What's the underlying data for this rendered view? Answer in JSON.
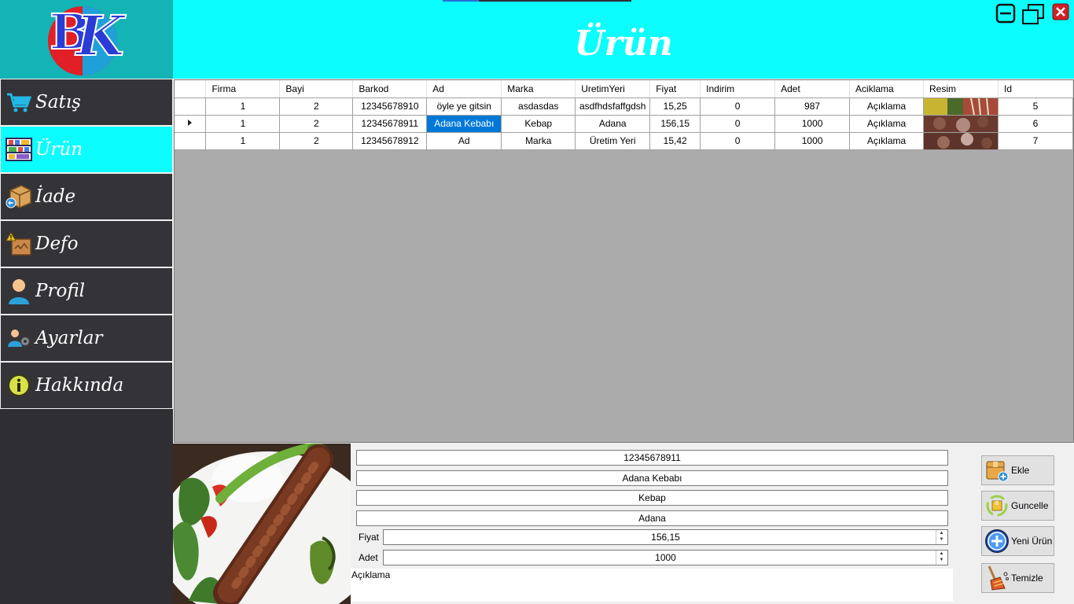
{
  "app": {
    "title": "Ürün"
  },
  "colors": {
    "accent": "#0cfdfd",
    "sidebar": "#2e2e33",
    "selection": "#0078d7",
    "grid_bg": "#ababab"
  },
  "sidebar": {
    "items": [
      {
        "label": "Satış",
        "icon": "cart-icon"
      },
      {
        "label": "Ürün",
        "icon": "shelves-icon",
        "active": true
      },
      {
        "label": "İade",
        "icon": "box-return-icon"
      },
      {
        "label": "Defo",
        "icon": "damaged-box-icon"
      },
      {
        "label": "Profil",
        "icon": "user-icon"
      },
      {
        "label": "Ayarlar",
        "icon": "user-gear-icon"
      },
      {
        "label": "Hakkında",
        "icon": "info-icon"
      }
    ]
  },
  "grid": {
    "columns": [
      "Firma",
      "Bayi",
      "Barkod",
      "Ad",
      "Marka",
      "UretimYeri",
      "Fiyat",
      "Indirim",
      "Adet",
      "Aciklama",
      "Resim",
      "Id"
    ],
    "rows": [
      [
        "1",
        "2",
        "12345678910",
        "öyle ye gitsin",
        "asdasdas",
        "asdfhdsfaffgdsh",
        "15,25",
        "0",
        "987",
        "Açıklama",
        "",
        "5"
      ],
      [
        "1",
        "2",
        "12345678911",
        "Adana Kebabı",
        "Kebap",
        "Adana",
        "156,15",
        "0",
        "1000",
        "Açıklama",
        "",
        "6"
      ],
      [
        "1",
        "2",
        "12345678912",
        "Ad",
        "Marka",
        "Üretim Yeri",
        "15,42",
        "0",
        "1000",
        "Açıklama",
        "",
        "7"
      ]
    ],
    "current_row": 1
  },
  "form": {
    "barkod": "12345678911",
    "ad": "Adana Kebabı",
    "marka": "Kebap",
    "uretim_yeri": "Adana",
    "fiyat_label": "Fiyat",
    "fiyat": "156,15",
    "adet_label": "Adet",
    "adet": "1000",
    "aciklama": "Açıklama"
  },
  "actions": {
    "ekle": "Ekle",
    "guncelle": "Guncelle",
    "yeni_urun": "Yeni Ürün",
    "temizle": "Temizle"
  }
}
